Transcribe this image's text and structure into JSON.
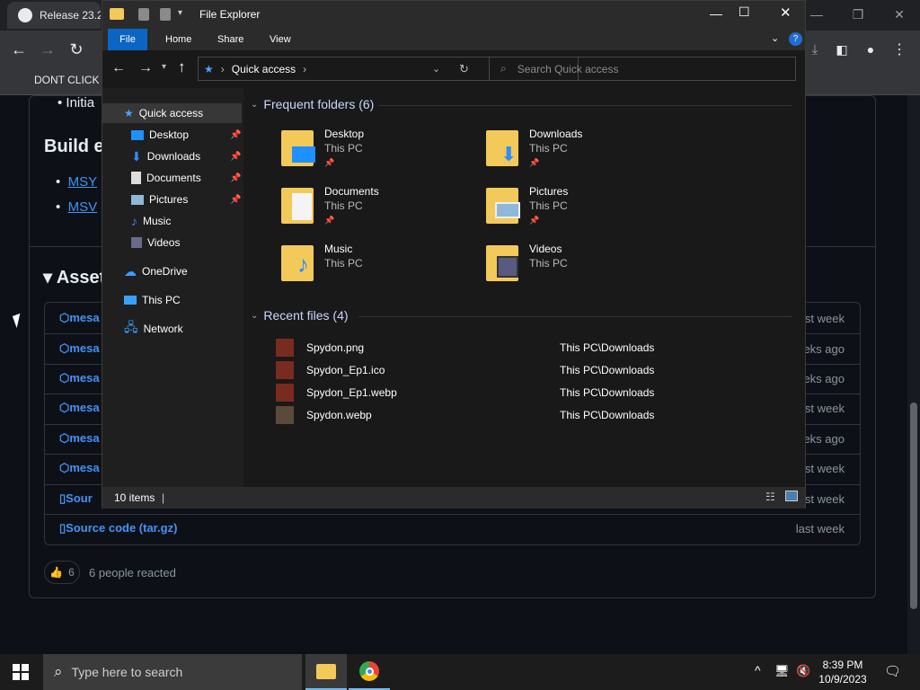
{
  "browser": {
    "tab_title": "Release 23.2.",
    "bookmark": "DONT CLICK"
  },
  "github": {
    "bullet_text": "Initia",
    "build_heading": "Build e",
    "build_links": [
      "MSY",
      "MSV"
    ],
    "assets_heading": "Asset",
    "assets": [
      {
        "name": "mesa",
        "time": "st week"
      },
      {
        "name": "mesa",
        "time": "eks ago"
      },
      {
        "name": "mesa",
        "time": "eks ago"
      },
      {
        "name": "mesa",
        "time": "st week"
      },
      {
        "name": "mesa",
        "time": "eks ago"
      },
      {
        "name": "mesa",
        "time": "st week"
      },
      {
        "name": "Sour",
        "time": "st week"
      },
      {
        "name": "Source code (tar.gz)",
        "time": "last week"
      }
    ],
    "reaction_count": "6",
    "reacted_text": "6 people reacted"
  },
  "explorer": {
    "title": "File Explorer",
    "ribbon_tabs": [
      "File",
      "Home",
      "Share",
      "View"
    ],
    "address": "Quick access",
    "search_placeholder": "Search Quick access",
    "nav": {
      "quick_access": "Quick access",
      "items": [
        "Desktop",
        "Downloads",
        "Documents",
        "Pictures",
        "Music",
        "Videos"
      ],
      "onedrive": "OneDrive",
      "this_pc": "This PC",
      "network": "Network"
    },
    "frequent_header": "Frequent folders (6)",
    "folders": [
      {
        "name": "Desktop",
        "location": "This PC"
      },
      {
        "name": "Downloads",
        "location": "This PC"
      },
      {
        "name": "Documents",
        "location": "This PC"
      },
      {
        "name": "Pictures",
        "location": "This PC"
      },
      {
        "name": "Music",
        "location": "This PC"
      },
      {
        "name": "Videos",
        "location": "This PC"
      }
    ],
    "recent_header": "Recent files (4)",
    "recent_files": [
      {
        "name": "Spydon.png",
        "path": "This PC\\Downloads"
      },
      {
        "name": "Spydon_Ep1.ico",
        "path": "This PC\\Downloads"
      },
      {
        "name": "Spydon_Ep1.webp",
        "path": "This PC\\Downloads"
      },
      {
        "name": "Spydon.webp",
        "path": "This PC\\Downloads"
      }
    ],
    "status": "10 items"
  },
  "taskbar": {
    "search_placeholder": "Type here to search",
    "time": "8:39 PM",
    "date": "10/9/2023"
  },
  "colors": {
    "accent_blue": "#4493f8",
    "folder_yellow": "#f3c95a",
    "explorer_bg": "#191919"
  }
}
